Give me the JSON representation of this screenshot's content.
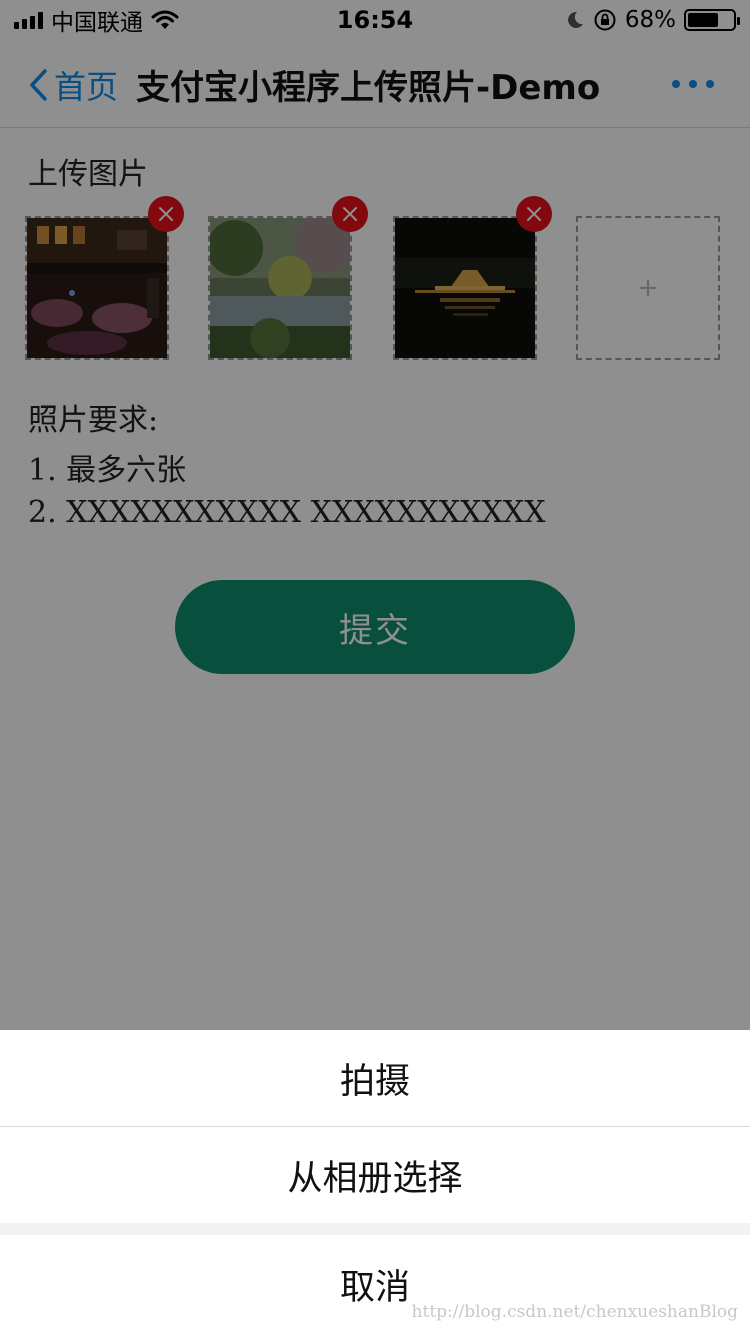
{
  "status_bar": {
    "carrier": "中国联通",
    "time": "16:54",
    "battery_text": "68%",
    "battery_level": 0.68
  },
  "nav": {
    "back_label": "首页",
    "title": "支付宝小程序上传照片-Demo"
  },
  "upload": {
    "section_title": "上传图片",
    "add_symbol": "+",
    "photos": [
      {
        "description_icon": "photo-restaurant-night"
      },
      {
        "description_icon": "photo-garden-pond"
      },
      {
        "description_icon": "photo-lake-lights-night"
      }
    ]
  },
  "requirements": {
    "heading": "照片要求:",
    "items": [
      "1. 最多六张",
      "2. XXXXXXXXXXX XXXXXXXXXXX"
    ]
  },
  "submit_label": "提交",
  "action_sheet": {
    "options": [
      "拍摄",
      "从相册选择"
    ],
    "cancel": "取消"
  },
  "watermark": "http://blog.csdn.net/chenxueshanBlog",
  "colors": {
    "accent_blue": "#108ee9",
    "submit_green": "#108e6d",
    "delete_red": "#e8101a"
  }
}
